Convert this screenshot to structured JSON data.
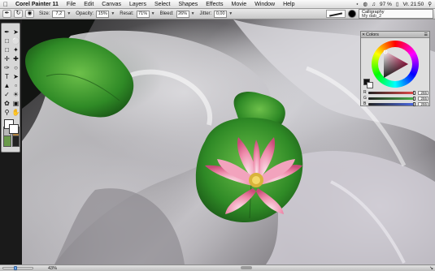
{
  "menubar": {
    "apple_icon": "apple-icon",
    "items": [
      "Corel Painter 11",
      "File",
      "Edit",
      "Canvas",
      "Layers",
      "Select",
      "Shapes",
      "Effects",
      "Movie",
      "Window",
      "Help"
    ],
    "status": {
      "battery": "97 %",
      "clock": "Vr. 21:50"
    }
  },
  "property_bar": {
    "size_label": "Size:",
    "size_value": "7,2",
    "opacity_label": "Opacity:",
    "opacity_value": "15%",
    "resat_label": "Resat:",
    "resat_value": "71%",
    "bleed_label": "Bleed:",
    "bleed_value": "26%",
    "jitter_label": "Jitter:",
    "jitter_value": "0,00",
    "brush_category": "Calligraphy",
    "brush_variant": "My dab_2"
  },
  "colors_panel": {
    "title": "Colors",
    "sliders": [
      {
        "channel": "R",
        "value": "255",
        "level": 1.0,
        "color": "#e84a4a"
      },
      {
        "channel": "G",
        "value": "255",
        "level": 1.0,
        "color": "#4ab54a"
      },
      {
        "channel": "B",
        "value": "255",
        "level": 1.0,
        "color": "#4a6ae8"
      }
    ]
  },
  "statusbar": {
    "zoom_value": "43%",
    "zoom_level": 0.43
  },
  "colors": {
    "canvas_dark": "#1a1a1a",
    "leaf_green": "#3c9a2e",
    "petal_pink": "#e86a8e"
  }
}
